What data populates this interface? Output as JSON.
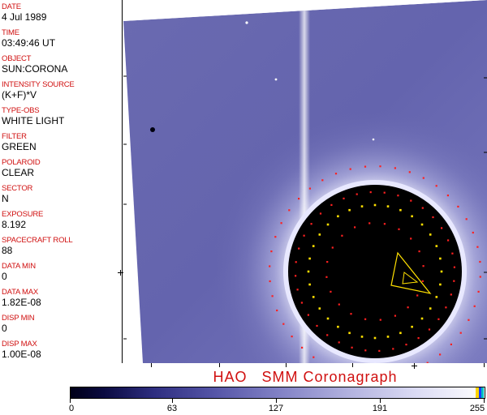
{
  "metadata": [
    {
      "label": "DATE",
      "value": "4 Jul 1989"
    },
    {
      "label": "TIME",
      "value": "03:49:46 UT"
    },
    {
      "label": "OBJECT",
      "value": "SUN:CORONA"
    },
    {
      "label": "INTENSITY SOURCE",
      "value": "(K+F)*V"
    },
    {
      "label": "TYPE-OBS",
      "value": "WHITE LIGHT"
    },
    {
      "label": "FILTER",
      "value": "GREEN"
    },
    {
      "label": "POLAROID",
      "value": "CLEAR"
    },
    {
      "label": "SECTOR",
      "value": "N"
    },
    {
      "label": "EXPOSURE",
      "value": "8.192"
    },
    {
      "label": "SPACECRAFT ROLL",
      "value": "88"
    },
    {
      "label": "DATA MIN",
      "value": "0"
    },
    {
      "label": "DATA MAX",
      "value": "1.82E-08"
    },
    {
      "label": "DISP MIN",
      "value": "0"
    },
    {
      "label": "DISP MAX",
      "value": "1.00E-08"
    }
  ],
  "caption": "HAO   SMM Coronagraph",
  "colorbar": {
    "tick_labels": [
      "0",
      "63",
      "127",
      "191",
      "255"
    ],
    "min": 0,
    "max": 255
  },
  "colors": {
    "label_red": "#d01010",
    "corona_blue": "#6a6ab4",
    "marker_red": "#ff2020",
    "marker_yellow": "#ffe000"
  }
}
